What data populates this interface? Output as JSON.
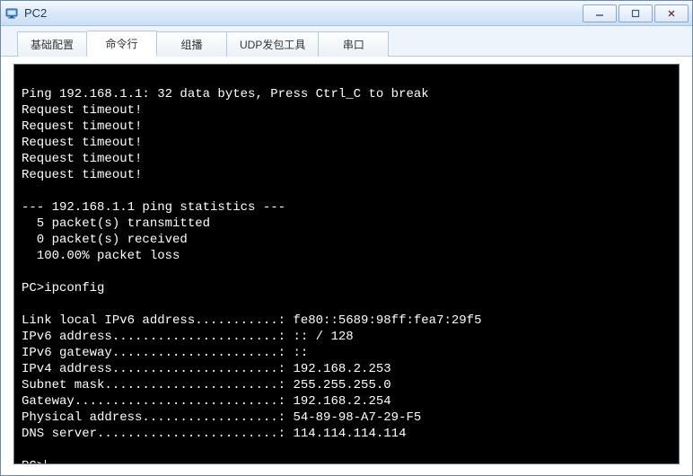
{
  "window": {
    "title": "PC2"
  },
  "tabs": [
    {
      "label": "基础配置"
    },
    {
      "label": "命令行"
    },
    {
      "label": "组播"
    },
    {
      "label": "UDP发包工具"
    },
    {
      "label": "串口"
    }
  ],
  "active_tab_index": 1,
  "terminal": {
    "lines": [
      "",
      "Ping 192.168.1.1: 32 data bytes, Press Ctrl_C to break",
      "Request timeout!",
      "Request timeout!",
      "Request timeout!",
      "Request timeout!",
      "Request timeout!",
      "",
      "--- 192.168.1.1 ping statistics ---",
      "  5 packet(s) transmitted",
      "  0 packet(s) received",
      "  100.00% packet loss",
      "",
      "PC>ipconfig",
      "",
      "Link local IPv6 address...........: fe80::5689:98ff:fea7:29f5",
      "IPv6 address......................: :: / 128",
      "IPv6 gateway......................: ::",
      "IPv4 address......................: 192.168.2.253",
      "Subnet mask.......................: 255.255.255.0",
      "Gateway...........................: 192.168.2.254",
      "Physical address..................: 54-89-98-A7-29-F5",
      "DNS server........................: 114.114.114.114",
      ""
    ],
    "prompt": "PC>"
  }
}
